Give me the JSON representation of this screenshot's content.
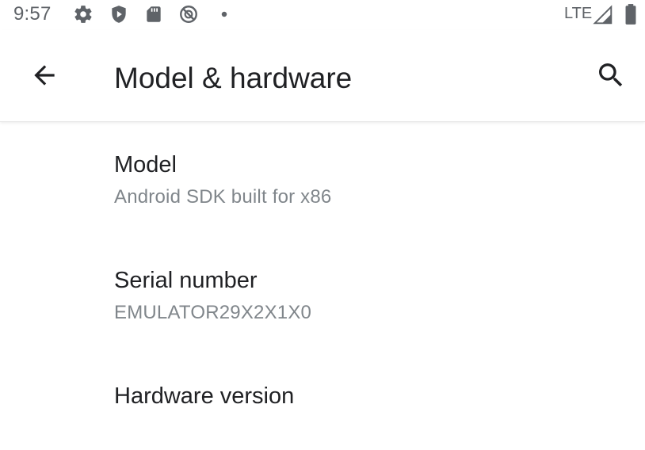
{
  "status_bar": {
    "time": "9:57",
    "icons": [
      "gear-icon",
      "shield-icon",
      "sd-card-icon",
      "no-entry-circle-icon",
      "dot-icon"
    ],
    "network_label": "LTE",
    "signal_icon": "signal-icon",
    "battery_icon": "battery-icon"
  },
  "app_bar": {
    "back_icon": "arrow-back-icon",
    "title": "Model & hardware",
    "search_icon": "search-icon"
  },
  "items": [
    {
      "title": "Model",
      "summary": "Android SDK built for x86"
    },
    {
      "title": "Serial number",
      "summary": "EMULATOR29X2X1X0"
    },
    {
      "title": "Hardware version",
      "summary": ""
    }
  ],
  "colors": {
    "background": "#ffffff",
    "primary_text": "#202124",
    "secondary_text": "#80868b",
    "status_icons": "#5f6368"
  }
}
